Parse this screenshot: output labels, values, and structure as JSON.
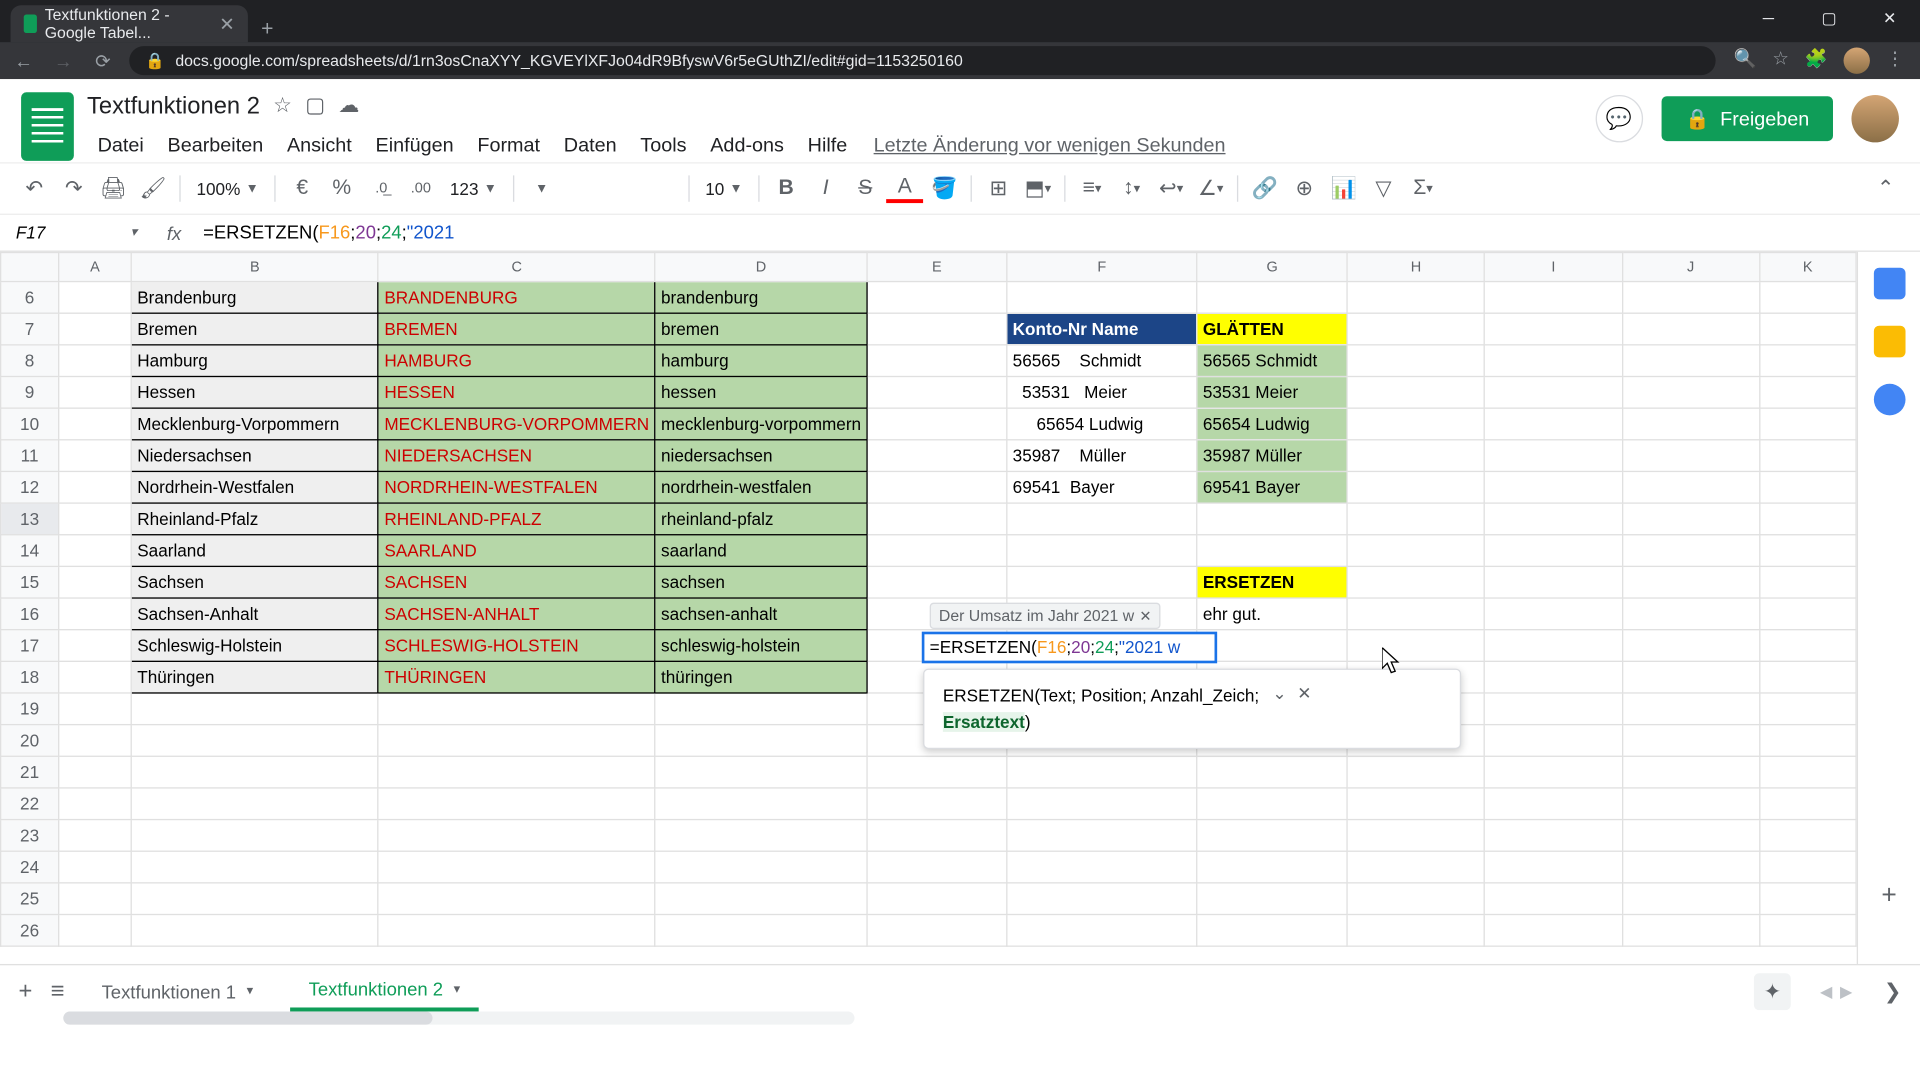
{
  "browser": {
    "tab_title": "Textfunktionen 2 - Google Tabel...",
    "url": "docs.google.com/spreadsheets/d/1rn3osCnaXYY_KGVEYlXFJo04dR9BfyswV6r5eGUthZI/edit#gid=1153250160"
  },
  "doc": {
    "title": "Textfunktionen 2",
    "last_edit": "Letzte Änderung vor wenigen Sekunden",
    "share_label": "Freigeben"
  },
  "menu": {
    "datei": "Datei",
    "bearbeiten": "Bearbeiten",
    "ansicht": "Ansicht",
    "einfuegen": "Einfügen",
    "format": "Format",
    "daten": "Daten",
    "tools": "Tools",
    "addons": "Add-ons",
    "hilfe": "Hilfe"
  },
  "toolbar": {
    "zoom": "100%",
    "font_size": "10",
    "currency": "€",
    "percent": "%",
    "dec_down": ".0",
    "dec_up": ".00",
    "num_format": "123"
  },
  "name_box": "F17",
  "formula": {
    "prefix": "=ERSETZEN(",
    "ref": "F16",
    "sep1": ";",
    "a2": "20",
    "sep2": ";",
    "a3": "24",
    "sep3": ";",
    "str": "\"2021",
    "str_edit": "\"2021 w"
  },
  "columns": [
    "A",
    "B",
    "C",
    "D",
    "E",
    "F",
    "G",
    "H",
    "I",
    "J",
    "K"
  ],
  "rows": [
    {
      "n": 6,
      "B": "Brandenburg",
      "C": "BRANDENBURG",
      "D": "brandenburg"
    },
    {
      "n": 7,
      "B": "Bremen",
      "C": "BREMEN",
      "D": "bremen",
      "F": "Konto-Nr Name",
      "G": "GLÄTTEN",
      "f_navy": true,
      "g_yellow": true
    },
    {
      "n": 8,
      "B": "Hamburg",
      "C": "HAMBURG",
      "D": "hamburg",
      "F": "56565    Schmidt",
      "G": "56565 Schmidt"
    },
    {
      "n": 9,
      "B": "Hessen",
      "C": "HESSEN",
      "D": "hessen",
      "F": "  53531   Meier",
      "G": "53531 Meier"
    },
    {
      "n": 10,
      "B": "Mecklenburg-Vorpommern",
      "C": "MECKLENBURG-VORPOMMERN",
      "D": "mecklenburg-vorpommern",
      "F": "     65654 Ludwig",
      "G": "65654 Ludwig"
    },
    {
      "n": 11,
      "B": "Niedersachsen",
      "C": "NIEDERSACHSEN",
      "D": "niedersachsen",
      "F": "35987    Müller",
      "G": "35987 Müller"
    },
    {
      "n": 12,
      "B": "Nordrhein-Westfalen",
      "C": "NORDRHEIN-WESTFALEN",
      "D": "nordrhein-westfalen",
      "F": "69541  Bayer",
      "G": "69541 Bayer"
    },
    {
      "n": 13,
      "B": "Rheinland-Pfalz",
      "C": "RHEINLAND-PFALZ",
      "D": "rheinland-pfalz"
    },
    {
      "n": 14,
      "B": "Saarland",
      "C": "SAARLAND",
      "D": "saarland"
    },
    {
      "n": 15,
      "B": "Sachsen",
      "C": "SACHSEN",
      "D": "sachsen",
      "G": "ERSETZEN",
      "g_yellow": true
    },
    {
      "n": 16,
      "B": "Sachsen-Anhalt",
      "C": "SACHSEN-ANHALT",
      "D": "sachsen-anhalt",
      "G": "ehr gut."
    },
    {
      "n": 17,
      "B": "Schleswig-Holstein",
      "C": "SCHLESWIG-HOLSTEIN",
      "D": "schleswig-holstein"
    },
    {
      "n": 18,
      "B": "Thüringen",
      "C": "THÜRINGEN",
      "D": "thüringen"
    },
    {
      "n": 19
    },
    {
      "n": 20
    },
    {
      "n": 21
    },
    {
      "n": 22
    },
    {
      "n": 23
    },
    {
      "n": 24
    },
    {
      "n": 25
    },
    {
      "n": 26
    }
  ],
  "preview_text": "Der Umsatz im Jahr 2021 w",
  "help": {
    "fn": "ERSETZEN",
    "sig1": "(Text; Position; Anzahl_Zeich;",
    "active": "Ersatztext",
    "sig2": ")"
  },
  "sheets": {
    "tab1": "Textfunktionen 1",
    "tab2": "Textfunktionen 2"
  }
}
